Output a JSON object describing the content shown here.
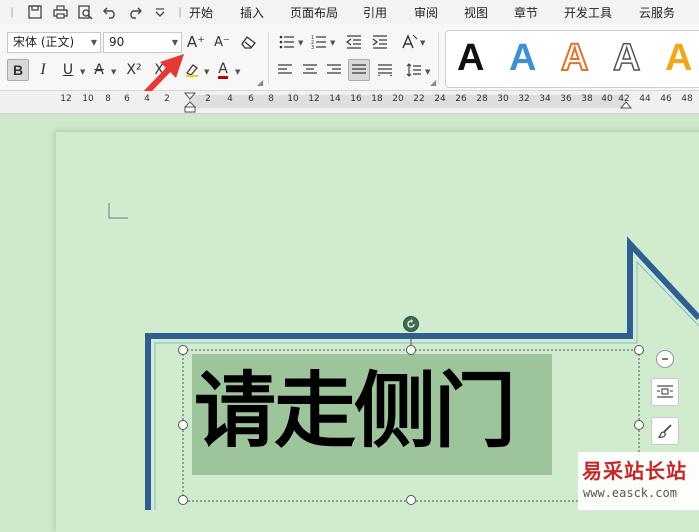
{
  "menu": {
    "tabs": [
      "开始",
      "插入",
      "页面布局",
      "引用",
      "审阅",
      "视图",
      "章节",
      "开发工具",
      "云服务"
    ]
  },
  "quick_access": {
    "icons": [
      "save-icon",
      "print-icon",
      "print-preview-icon",
      "undo-icon",
      "redo-icon",
      "customize-dropdown-icon"
    ]
  },
  "font": {
    "family": "宋体 (正文)",
    "size": "90"
  },
  "format_buttons": {
    "bold": "B",
    "italic": "I",
    "underline": "U",
    "strikethrough": "A",
    "superscript": "X²",
    "font_color": "A",
    "grow": "A⁺",
    "shrink": "A⁻"
  },
  "text_styles": [
    "A",
    "A",
    "A",
    "A",
    "A"
  ],
  "colors": {
    "canvas_bg": "#cfe8cc",
    "shape_outline": "#2f5e93",
    "text_fill": "#9dc49a",
    "style_blue": "#3f8fd4",
    "style_orange": "#e0742c",
    "style_gold": "#f2a71b",
    "arrow_red": "#e53935",
    "font_color_bar": "#c00000"
  },
  "ruler": {
    "labels": [
      "12",
      "10",
      "8",
      "6",
      "4",
      "2",
      "2",
      "4",
      "6",
      "8",
      "10",
      "12",
      "14",
      "16",
      "18",
      "20",
      "22",
      "24",
      "26",
      "28",
      "30",
      "32",
      "34",
      "36",
      "38",
      "40",
      "42",
      "44",
      "46",
      "48"
    ]
  },
  "document": {
    "text": "请走侧门"
  },
  "watermark": {
    "title": "易采站长站",
    "url": "www.easck.com"
  }
}
